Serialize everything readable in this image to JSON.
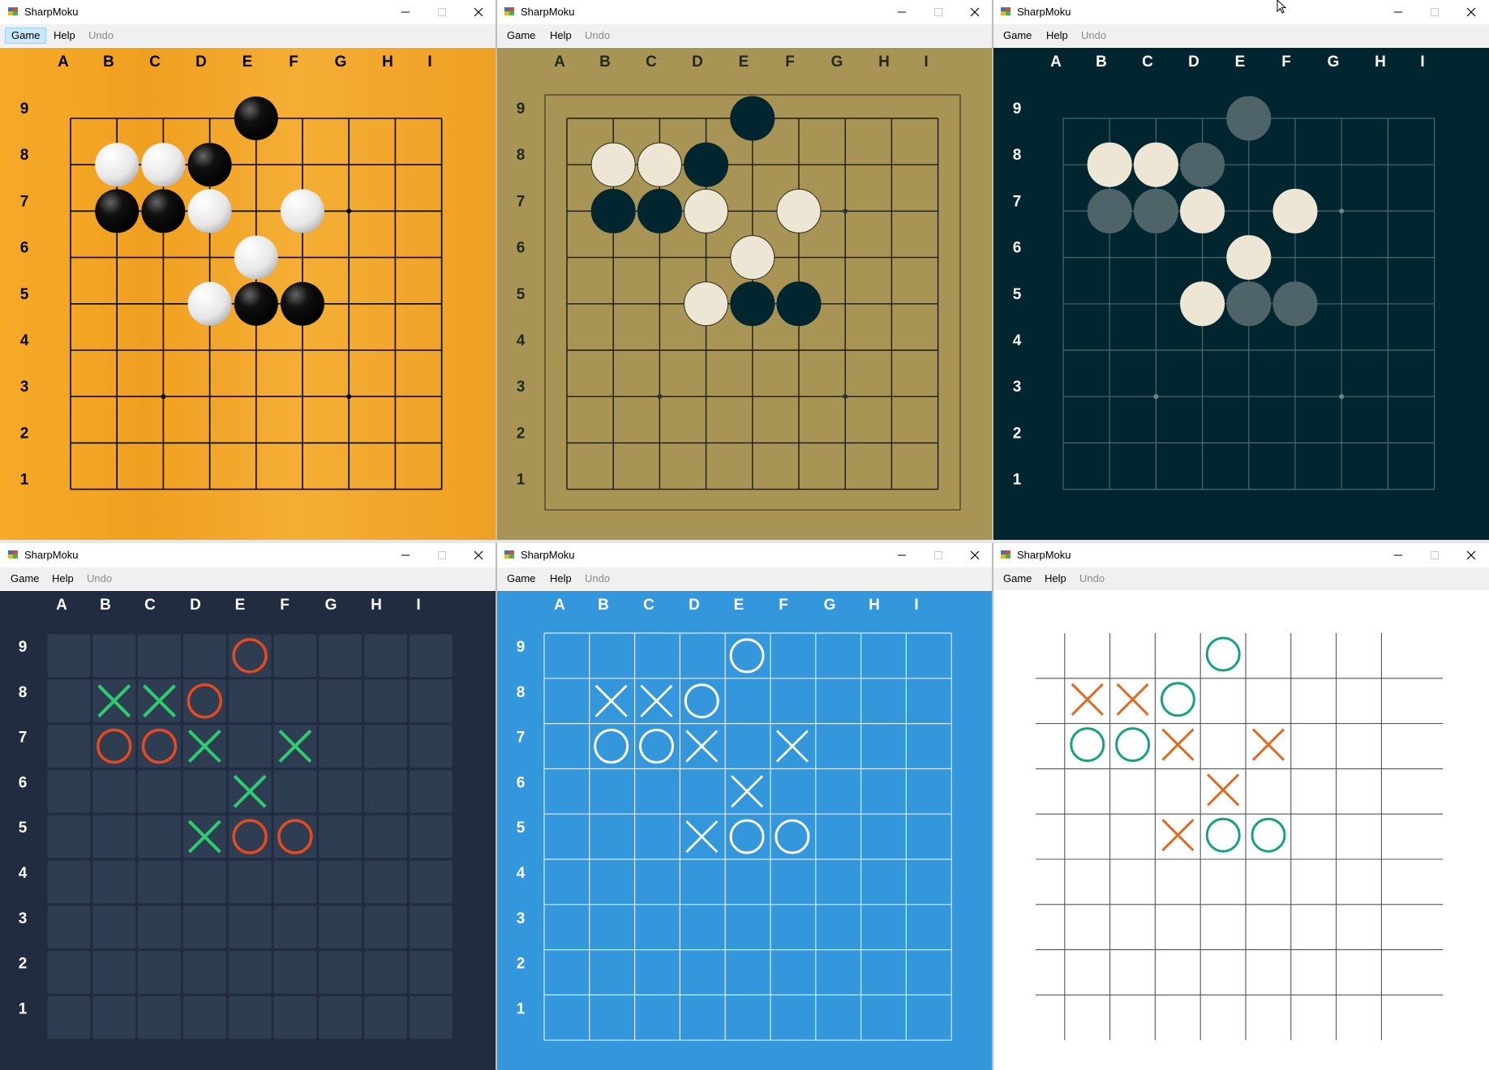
{
  "windows": [
    {
      "title": "SharpMoku",
      "menu": [
        "Game",
        "Help",
        "Undo"
      ],
      "theme": "wood-stones"
    },
    {
      "title": "SharpMoku",
      "menu": [
        "Game",
        "Help",
        "Undo"
      ],
      "theme": "olive-stones"
    },
    {
      "title": "SharpMoku",
      "menu": [
        "Game",
        "Help",
        "Undo"
      ],
      "theme": "dark-teal-stones"
    },
    {
      "title": "SharpMoku",
      "menu": [
        "Game",
        "Help",
        "Undo"
      ],
      "theme": "navy-tiles-xo"
    },
    {
      "title": "SharpMoku",
      "menu": [
        "Game",
        "Help",
        "Undo"
      ],
      "theme": "blue-grid-xo"
    },
    {
      "title": "SharpMoku",
      "menu": [
        "Game",
        "Help",
        "Undo"
      ],
      "theme": "white-grid-xo"
    }
  ],
  "board": {
    "columns": [
      "A",
      "B",
      "C",
      "D",
      "E",
      "F",
      "G",
      "H",
      "I"
    ],
    "rows": [
      "9",
      "8",
      "7",
      "6",
      "5",
      "4",
      "3",
      "2",
      "1"
    ],
    "black_stones": [
      "E9",
      "D8",
      "B7",
      "C7",
      "E5",
      "F5"
    ],
    "white_stones": [
      "B8",
      "C8",
      "D7",
      "F7",
      "E6",
      "D5"
    ]
  },
  "colors": {
    "wood_bg": "#f2a625",
    "olive_bg": "#a89454",
    "dark_bg": "#012630",
    "navy_bg": "#222c40",
    "blue_bg": "#3497db",
    "x_green": "#2ecc71",
    "o_red": "#e84a1f",
    "o_teal": "#16a085",
    "x_orange": "#e06a22"
  }
}
